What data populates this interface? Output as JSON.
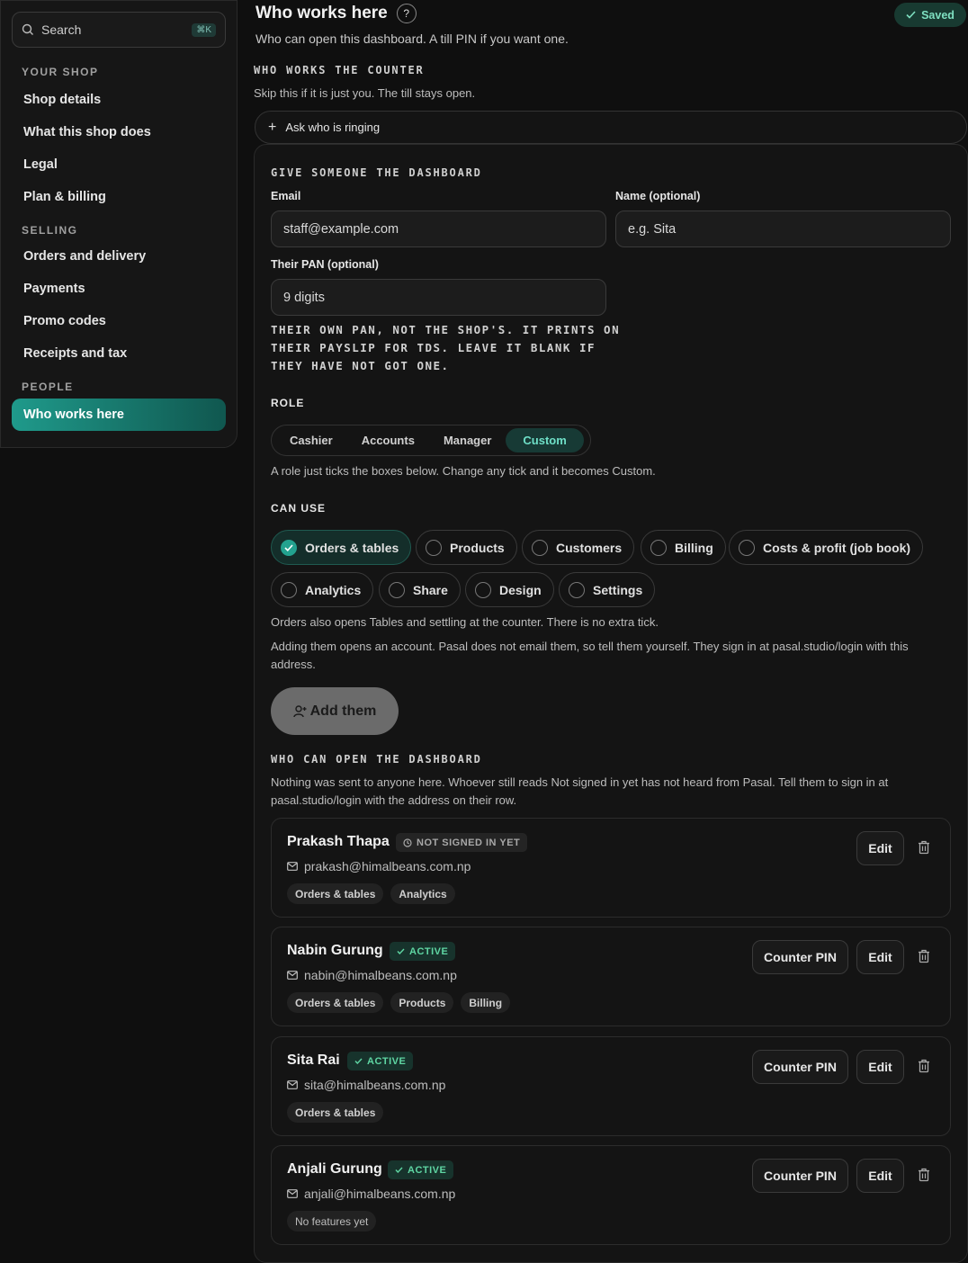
{
  "sidebar": {
    "search_label": "Search",
    "search_kbd": "⌘K",
    "sections": [
      {
        "title": "YOUR SHOP",
        "items": [
          "Shop details",
          "What this shop does",
          "Legal",
          "Plan & billing"
        ]
      },
      {
        "title": "SELLING",
        "items": [
          "Orders and delivery",
          "Payments",
          "Promo codes",
          "Receipts and tax"
        ]
      },
      {
        "title": "PEOPLE",
        "items": [
          "Who works here"
        ]
      }
    ],
    "active_item": "Who works here"
  },
  "header": {
    "title": "Who works here",
    "help": "?",
    "saved": "Saved",
    "subtitle": "Who can open this dashboard. A till PIN if you want one."
  },
  "counter": {
    "heading": "WHO WORKS THE COUNTER",
    "note": "Skip this if it is just you. The till stays open.",
    "ask_label": "Ask who is ringing"
  },
  "form": {
    "heading": "GIVE SOMEONE THE DASHBOARD",
    "email_label": "Email",
    "email_placeholder": "staff@example.com",
    "name_label": "Name (optional)",
    "name_placeholder": "e.g. Sita",
    "pan_label": "Their PAN (optional)",
    "pan_placeholder": "9 digits",
    "pan_help": "THEIR OWN PAN, NOT THE SHOP'S. IT PRINTS ON THEIR PAYSLIP FOR TDS. LEAVE IT BLANK IF THEY HAVE NOT GOT ONE.",
    "role_label": "ROLE",
    "roles": [
      "Cashier",
      "Accounts",
      "Manager",
      "Custom"
    ],
    "role_selected": "Custom",
    "role_note": "A role just ticks the boxes below. Change any tick and it becomes Custom.",
    "can_use_label": "CAN USE",
    "permissions": [
      {
        "label": "Orders & tables",
        "checked": true
      },
      {
        "label": "Products",
        "checked": false
      },
      {
        "label": "Customers",
        "checked": false
      },
      {
        "label": "Billing",
        "checked": false
      },
      {
        "label": "Costs & profit (job book)",
        "checked": false
      },
      {
        "label": "Analytics",
        "checked": false
      },
      {
        "label": "Share",
        "checked": false
      },
      {
        "label": "Design",
        "checked": false
      },
      {
        "label": "Settings",
        "checked": false
      }
    ],
    "orders_note": "Orders also opens Tables and settling at the counter. There is no extra tick.",
    "account_note": "Adding them opens an account. Pasal does not email them, so tell them yourself. They sign in at pasal.studio/login with this address.",
    "add_label": "Add them"
  },
  "team": {
    "heading": "WHO CAN OPEN THE DASHBOARD",
    "note": "Nothing was sent to anyone here. Whoever still reads Not signed in yet has not heard from Pasal. Tell them to sign in at pasal.studio/login with the address on their row.",
    "members": [
      {
        "name": "Prakash Thapa",
        "status": "NOT SIGNED IN YET",
        "email": "prakash@himalbeans.com.np",
        "tags": [
          "Orders & tables",
          "Analytics"
        ],
        "pin": null
      },
      {
        "name": "Nabin Gurung",
        "status": "ACTIVE",
        "email": "nabin@himalbeans.com.np",
        "tags": [
          "Orders & tables",
          "Products",
          "Billing"
        ],
        "pin": "Counter PIN"
      },
      {
        "name": "Sita Rai",
        "status": "ACTIVE",
        "email": "sita@himalbeans.com.np",
        "tags": [
          "Orders & tables"
        ],
        "pin": "Counter PIN"
      },
      {
        "name": "Anjali Gurung",
        "status": "ACTIVE",
        "email": "anjali@himalbeans.com.np",
        "tags": [
          "No features yet"
        ],
        "pin": "Counter PIN"
      }
    ],
    "edit_label": "Edit"
  },
  "colors": {
    "accent": "#23a28f",
    "active": "#5fd6a3",
    "background": "#0f0f0f"
  }
}
